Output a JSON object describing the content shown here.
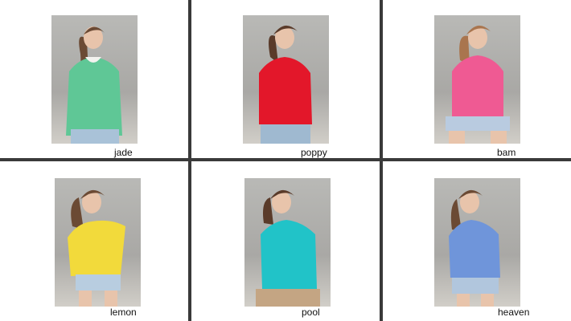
{
  "products": [
    {
      "name": "jade",
      "sweater_color": "#5fc796"
    },
    {
      "name": "poppy",
      "sweater_color": "#e3172a"
    },
    {
      "name": "bam",
      "sweater_color": "#ef5a93"
    },
    {
      "name": "lemon",
      "sweater_color": "#f2da3b"
    },
    {
      "name": "pool",
      "sweater_color": "#21c3c8"
    },
    {
      "name": "heaven",
      "sweater_color": "#6f95da"
    }
  ]
}
